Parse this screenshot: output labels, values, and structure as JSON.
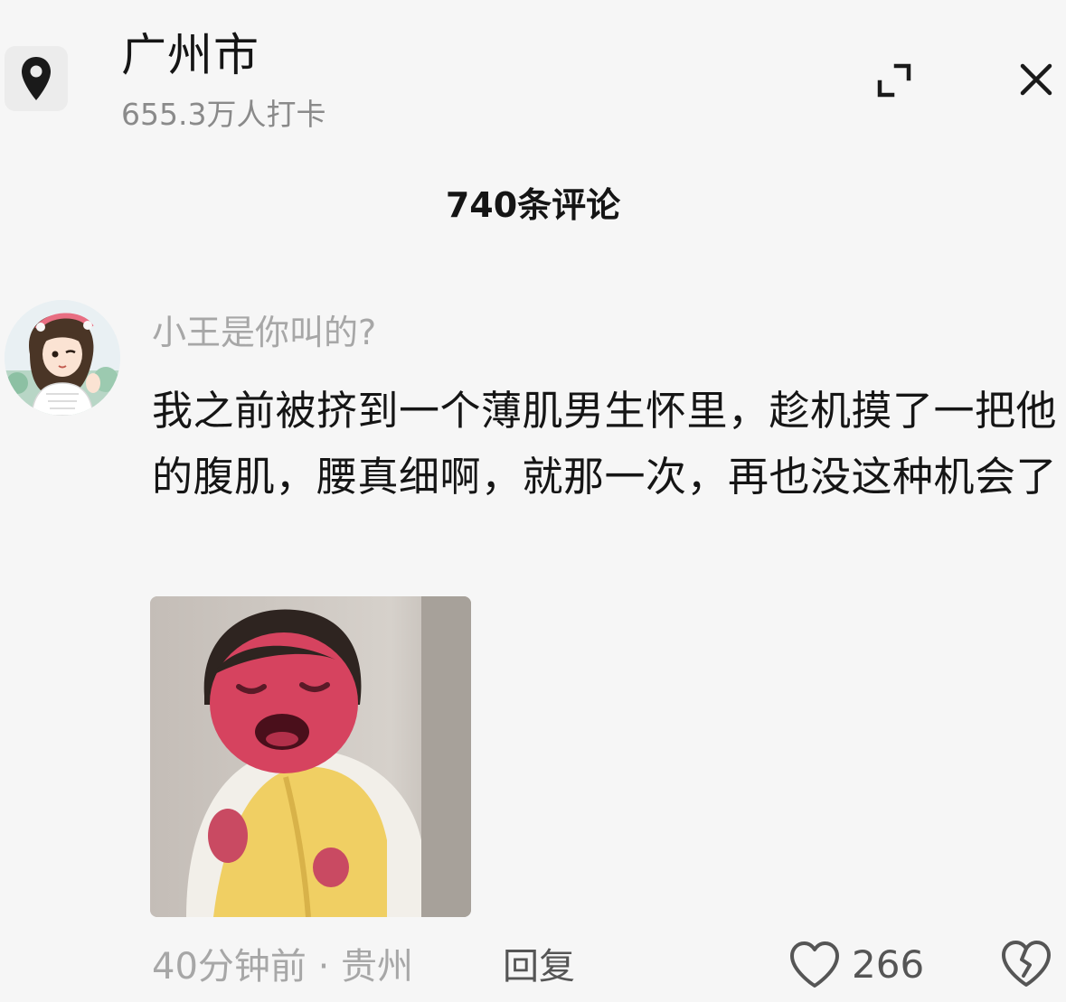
{
  "header": {
    "location_icon": "map-pin-icon",
    "title": "广州市",
    "subtitle": "655.3万人打卡",
    "expand_icon": "collapse-expand-icon",
    "close_icon": "close-icon"
  },
  "comments_header": {
    "count_label": "740条评论"
  },
  "comment": {
    "username": "小王是你叫的?",
    "text": "我之前被挤到一个薄肌男生怀里，趁机摸了一把他的腹肌，腰真细啊，就那一次，再也没这种机会了",
    "image_icon": "crying-child-sticker",
    "meta": "40分钟前 · 贵州",
    "reply_label": "回复",
    "like_icon": "heart-icon",
    "like_count": "266",
    "dislike_icon": "broken-heart-icon"
  },
  "colors": {
    "background": "#f6f6f6",
    "primary_text": "#151515",
    "secondary_text": "#a7a7a7",
    "icon": "#1a1a1a"
  }
}
